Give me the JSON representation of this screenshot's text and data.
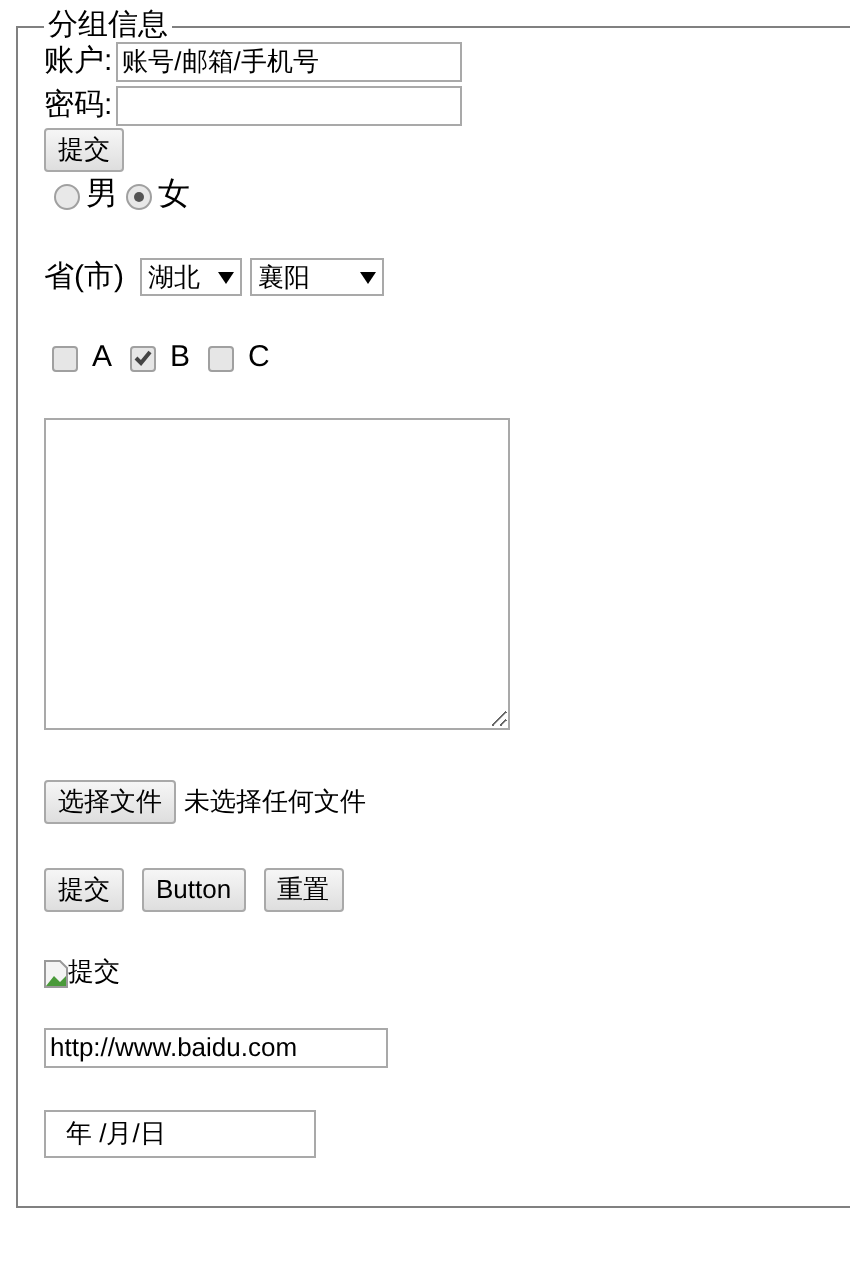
{
  "fieldset": {
    "legend": "分组信息"
  },
  "account": {
    "label": "账户:",
    "value": "账号/邮箱/手机号"
  },
  "password": {
    "label": "密码:"
  },
  "submit_button": "提交",
  "gender": [
    {
      "label": "男",
      "selected": false
    },
    {
      "label": "女",
      "selected": true
    }
  ],
  "region": {
    "label": "省(市)",
    "province": "湖北",
    "city": "襄阳"
  },
  "options": [
    {
      "label": "A",
      "checked": false
    },
    {
      "label": "B",
      "checked": true
    },
    {
      "label": "C",
      "checked": false
    }
  ],
  "file": {
    "button": "选择文件",
    "status": "未选择任何文件"
  },
  "buttons": [
    "提交",
    "Button",
    "重置"
  ],
  "image_alt": "提交",
  "url": {
    "value": "http://www.baidu.com"
  },
  "date": {
    "value": "年 /月/日"
  }
}
